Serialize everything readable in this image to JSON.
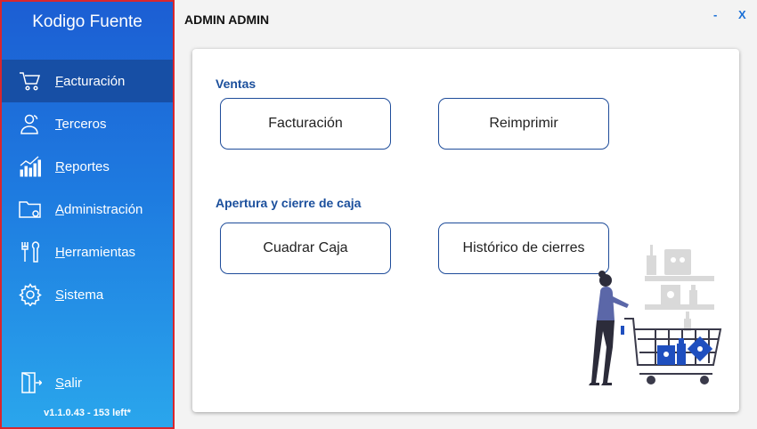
{
  "sidebar": {
    "brand": "Kodigo Fuente",
    "items": [
      {
        "label": "Facturación",
        "icon": "cart-icon"
      },
      {
        "label": "Terceros",
        "icon": "users-icon"
      },
      {
        "label": "Reportes",
        "icon": "chart-icon"
      },
      {
        "label": "Administración",
        "icon": "folder-icon"
      },
      {
        "label": "Herramientas",
        "icon": "tools-icon"
      },
      {
        "label": "Sistema",
        "icon": "gear-icon"
      }
    ],
    "exit_label": "Salir",
    "version": "v1.1.0.43 - 153 left*"
  },
  "header": {
    "title": "ADMIN ADMIN",
    "minimize": "-",
    "close": "X"
  },
  "main": {
    "sections": [
      {
        "title": "Ventas",
        "buttons": [
          "Facturación",
          "Reimprimir"
        ]
      },
      {
        "title": "Apertura y cierre de caja",
        "buttons": [
          "Cuadrar Caja",
          "Histórico de cierres"
        ]
      }
    ],
    "illustration": "shopping-cart-illustration"
  },
  "colors": {
    "sidebar_top": "#1c5ed3",
    "sidebar_bottom": "#2aa6ec",
    "active_item": "#174fa5",
    "accent": "#1b4f9c",
    "border_highlight": "#d9262d"
  }
}
